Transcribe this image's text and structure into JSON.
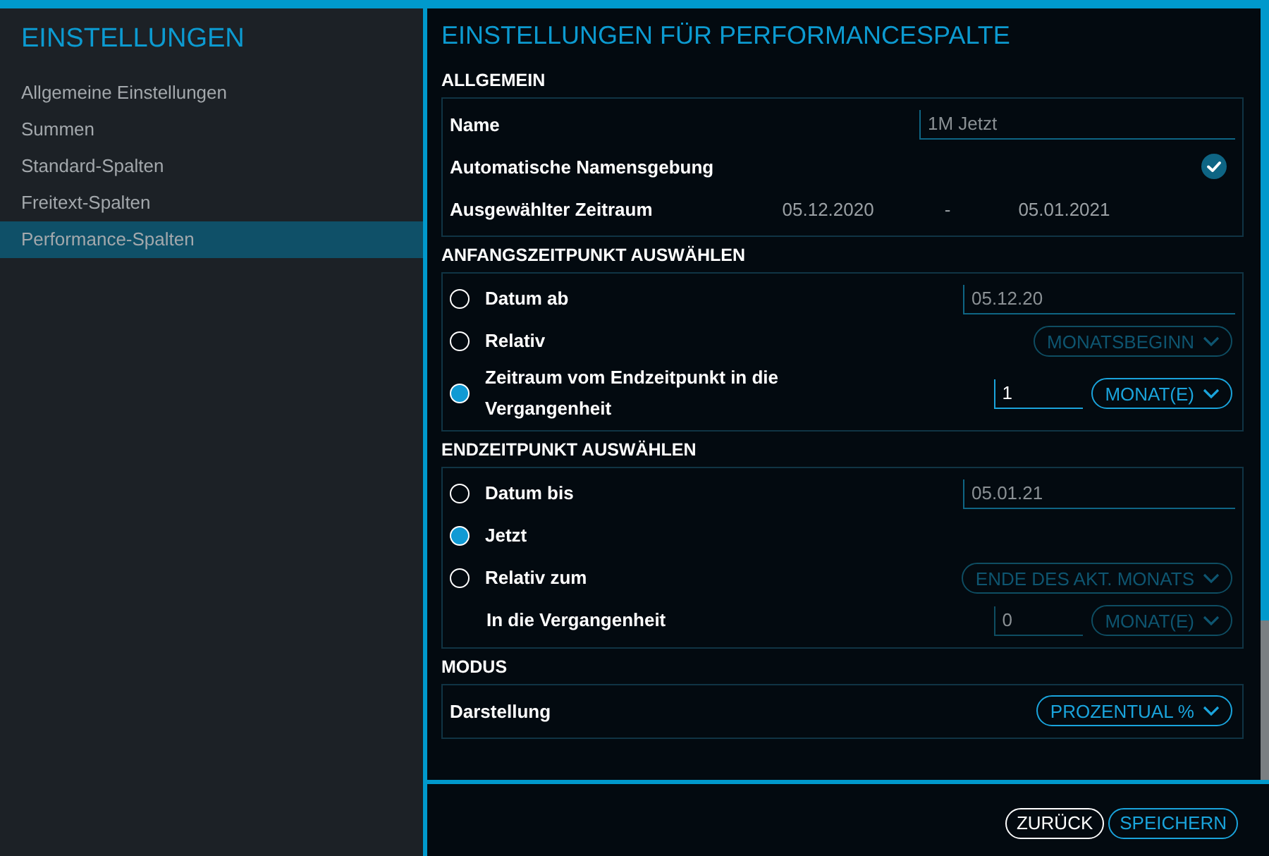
{
  "sidebar": {
    "title": "EINSTELLUNGEN",
    "items": [
      {
        "label": "Allgemeine Einstellungen",
        "selected": false
      },
      {
        "label": "Summen",
        "selected": false
      },
      {
        "label": "Standard-Spalten",
        "selected": false
      },
      {
        "label": "Freitext-Spalten",
        "selected": false
      },
      {
        "label": "Performance-Spalten",
        "selected": true
      }
    ]
  },
  "panel": {
    "title": "EINSTELLUNGEN FÜR PERFORMANCESPALTE",
    "sections": [
      {
        "heading": "ALLGEMEIN",
        "rows": [
          {
            "kind": "text",
            "label": "Name",
            "field": {
              "value": "1M Jetzt",
              "disabled": true
            }
          },
          {
            "kind": "check",
            "label": "Automatische Namensgebung",
            "checked": true
          },
          {
            "kind": "range",
            "label": "Ausgewählter Zeitraum",
            "from": "05.12.2020",
            "separator": "-",
            "to": "05.01.2021"
          }
        ]
      },
      {
        "heading": "ANFANGSZEITPUNKT AUSWÄHLEN",
        "rows": [
          {
            "kind": "radio",
            "label": "Datum ab",
            "selected": false,
            "field": {
              "value": "05.12.20",
              "disabled": true
            }
          },
          {
            "kind": "radio",
            "label": "Relativ",
            "selected": false,
            "dropdown": {
              "value": "MONATSBEGINN",
              "disabled": true
            }
          },
          {
            "kind": "radio",
            "label": "Zeitraum vom Endzeitpunkt in die Vergangenheit",
            "selected": true,
            "number": {
              "value": "1",
              "disabled": false
            },
            "dropdown": {
              "value": "MONAT(E)",
              "disabled": false
            }
          }
        ]
      },
      {
        "heading": "ENDZEITPUNKT AUSWÄHLEN",
        "rows": [
          {
            "kind": "radio",
            "label": "Datum bis",
            "selected": false,
            "field": {
              "value": "05.01.21",
              "disabled": true
            }
          },
          {
            "kind": "radio",
            "label": "Jetzt",
            "selected": true
          },
          {
            "kind": "radio",
            "label": "Relativ zum",
            "selected": false,
            "dropdown": {
              "value": "ENDE DES AKT. MONATS",
              "disabled": true
            }
          },
          {
            "kind": "indent",
            "label": "In die Vergangenheit",
            "number": {
              "value": "0",
              "disabled": true
            },
            "dropdown": {
              "value": "MONAT(E)",
              "disabled": true
            }
          }
        ]
      },
      {
        "heading": "MODUS",
        "rows": [
          {
            "kind": "text",
            "label": "Darstellung",
            "dropdown": {
              "value": "PROZENTUAL %",
              "disabled": false
            }
          }
        ]
      }
    ]
  },
  "buttons": [
    {
      "label": "ZURÜCK",
      "kind": "secondary"
    },
    {
      "label": "SPEICHERN",
      "kind": "primary"
    }
  ]
}
